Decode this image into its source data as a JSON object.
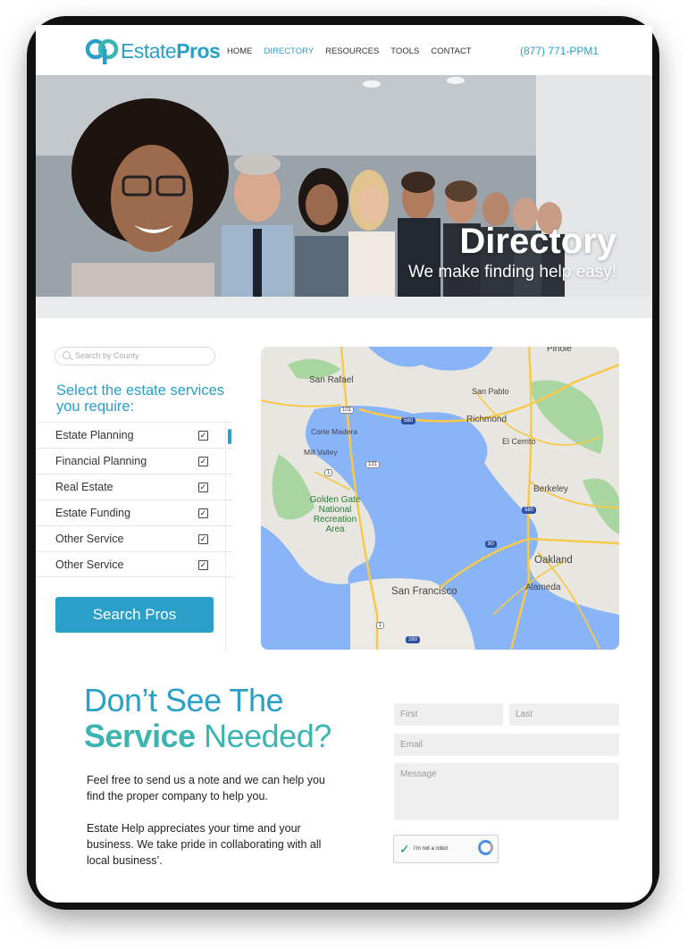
{
  "header": {
    "logo_text_light": "Estate",
    "logo_text_bold": "Pros",
    "nav": [
      "HOME",
      "DIRECTORY",
      "RESOURCES",
      "TOOLS",
      "CONTACT"
    ],
    "active_nav": "DIRECTORY",
    "phone": "(877) 771-PPM1"
  },
  "hero": {
    "title": "Directory",
    "subtitle": "We make finding help easy!"
  },
  "search": {
    "placeholder": "Search by County"
  },
  "services": {
    "heading": "Select the estate services you require:",
    "items": [
      {
        "label": "Estate Planning",
        "checked": true
      },
      {
        "label": "Financial Planning",
        "checked": true
      },
      {
        "label": "Real Estate",
        "checked": true
      },
      {
        "label": "Estate Funding",
        "checked": true
      },
      {
        "label": "Other Service",
        "checked": true
      },
      {
        "label": "Other Service",
        "checked": true
      }
    ],
    "button": "Search Pros"
  },
  "map": {
    "labels": {
      "pinole": "Pinole",
      "san_rafael": "San Rafael",
      "san_pablo": "San Pablo",
      "richmond": "Richmond",
      "corte_madera": "Corte Madera",
      "el_cerrito": "El Cerrito",
      "mill_valley": "Mill Valley",
      "berkeley": "Berkeley",
      "golden_gate": "Golden Gate National Recreation Area",
      "oakland": "Oakland",
      "alameda": "Alameda",
      "san_francisco": "San Francisco"
    },
    "shields": [
      "101",
      "580",
      "131",
      "1",
      "580",
      "80",
      "1",
      "280"
    ]
  },
  "contact": {
    "heading_line1": "Don’t See The",
    "heading_bold": "Service",
    "heading_rest": " Needed?",
    "paragraph1": "Feel free to send us a note and we can help you find the proper company to help you.",
    "paragraph2": "Estate Help appreciates your time and your business. We take pride in collaborating with all local business’.",
    "first_placeholder": "First",
    "last_placeholder": "Last",
    "email_placeholder": "Email",
    "message_placeholder": "Message",
    "captcha_label": "I'm not a robot"
  },
  "colors": {
    "brand": "#2a9fc7",
    "accent": "#3bb4b2",
    "water": "#8ab4f8"
  }
}
